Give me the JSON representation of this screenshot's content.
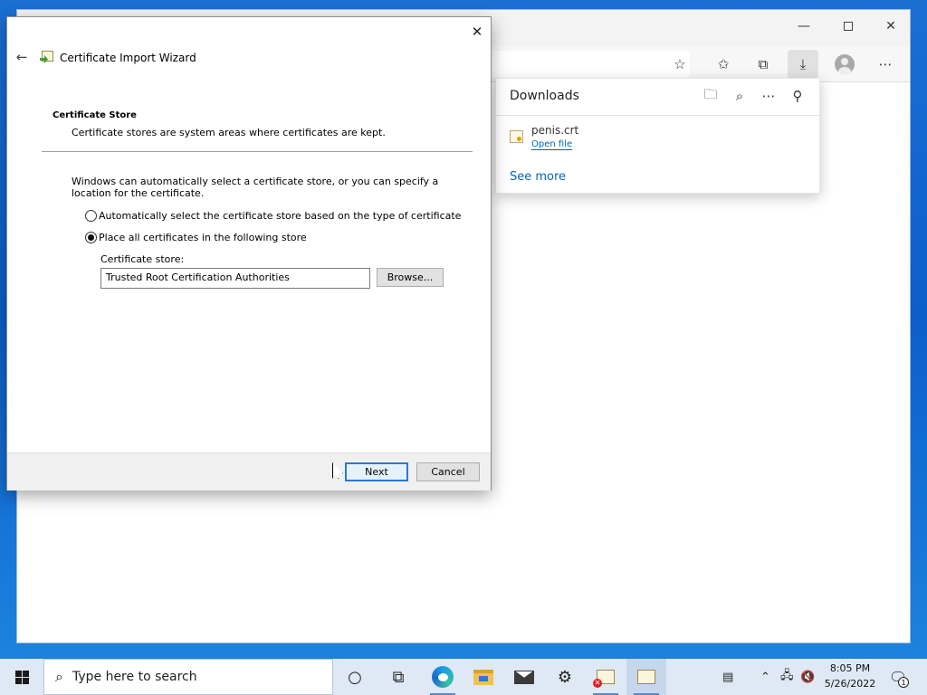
{
  "wizard": {
    "title": "Certificate Import Wizard",
    "heading": "Certificate Store",
    "subheading": "Certificate stores are system areas where certificates are kept.",
    "description": "Windows can automatically select a certificate store, or you can specify a location for the certificate.",
    "radio_auto_label": "Automatically select the certificate store based on the type of certificate",
    "radio_place_label": "Place all certificates in the following store",
    "selected_option": "Place all certificates in the following store",
    "store_label": "Certificate store:",
    "store_value": "Trusted Root Certification Authorities",
    "browse_label": "Browse...",
    "next_label": "Next",
    "cancel_label": "Cancel"
  },
  "downloads": {
    "title": "Downloads",
    "file_name": "penis.crt",
    "open_file_label": "Open file",
    "see_more_label": "See more"
  },
  "taskbar": {
    "search_placeholder": "Type here to search",
    "time": "8:05 PM",
    "date": "5/26/2022",
    "notification_count": "1"
  },
  "colors": {
    "accent": "#0067b8",
    "desktop": "#0c5ec9",
    "taskbar": "#dfe9f5"
  }
}
